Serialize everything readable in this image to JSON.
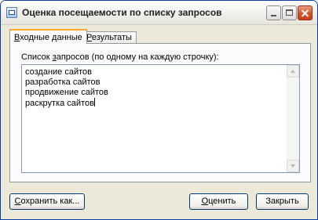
{
  "window": {
    "title": "Оценка посещаемости по списку запросов",
    "icon": "app-window-icon",
    "controls": {
      "minimize": "minimize-icon",
      "maximize": "maximize-icon",
      "close": "close-icon"
    }
  },
  "tabs": [
    {
      "hotkey": "В",
      "rest": "ходные данные",
      "active": true
    },
    {
      "hotkey": "Р",
      "rest": "езультаты",
      "active": false
    }
  ],
  "input_tab": {
    "label_before": "Список ",
    "label_hotkey": "з",
    "label_after": "апросов (по одному на каждую строчку):",
    "lines": [
      "создание сайтов",
      "разработка сайтов",
      "продвижение сайтов",
      "раскрутка сайтов"
    ]
  },
  "buttons": {
    "save": {
      "hotkey": "С",
      "rest": "охранить как..."
    },
    "evaluate": {
      "hotkey": "О",
      "rest": "ценить"
    },
    "close": {
      "label": "Закрыть"
    }
  },
  "colors": {
    "active_tab_accent": "#f7a92a",
    "window_border": "#0b3fa6",
    "close_button": "#d5532e"
  }
}
